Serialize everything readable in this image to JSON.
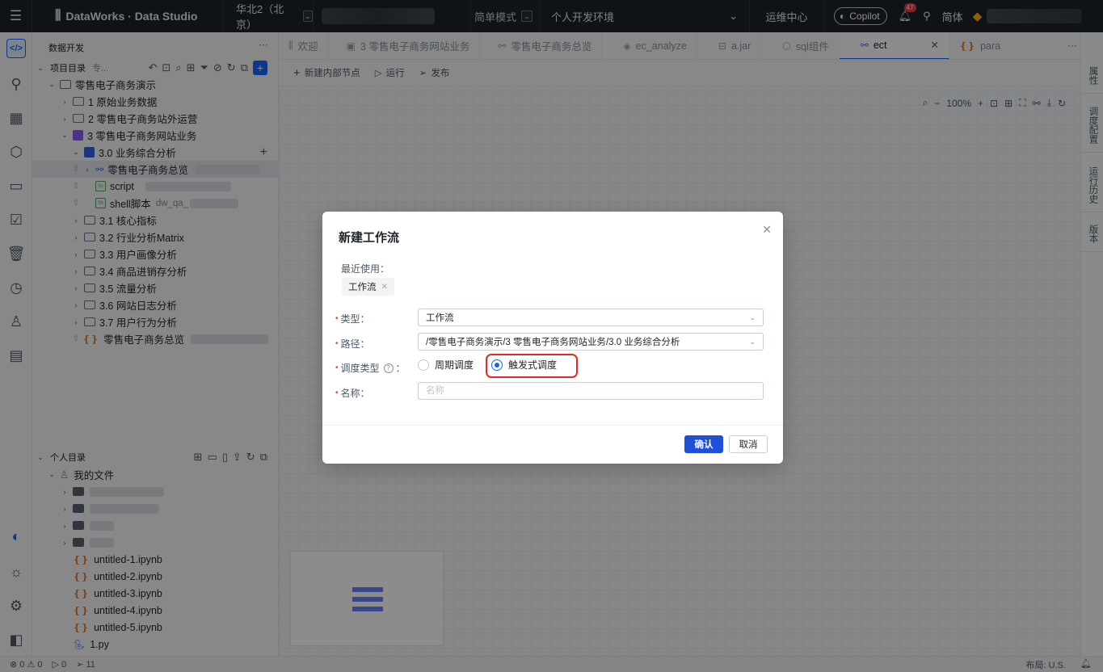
{
  "topbar": {
    "brand": "DataWorks · Data Studio",
    "region": "华北2（北京）",
    "mode": "简单模式",
    "environment": "个人开发环境",
    "ops_center": "运维中心",
    "copilot": "Copilot",
    "notifications": "47",
    "language": "简体"
  },
  "sidebar": {
    "title": "数据开发",
    "project_section": "项目目录",
    "project_section_suffix": "专...",
    "tree": [
      {
        "label": "零售电子商务演示"
      },
      {
        "label": "1 原始业务数据"
      },
      {
        "label": "2 零售电子商务站外运营"
      },
      {
        "label": "3 零售电子商务网站业务"
      },
      {
        "label": "3.0 业务综合分析"
      },
      {
        "label": "零售电子商务总览"
      },
      {
        "label": "script"
      },
      {
        "label": "shell脚本",
        "suffix": "dw_qa_"
      },
      {
        "label": "3.1 核心指标"
      },
      {
        "label": "3.2 行业分析Matrix"
      },
      {
        "label": "3.3 用户画像分析"
      },
      {
        "label": "3.4 商品进销存分析"
      },
      {
        "label": "3.5 流量分析"
      },
      {
        "label": "3.6 网站日志分析"
      },
      {
        "label": "3.7 用户行为分析"
      },
      {
        "label": "零售电子商务总览"
      }
    ],
    "personal_section": "个人目录",
    "my_files": "我的文件",
    "files": [
      "untitled-1.ipynb",
      "untitled-2.ipynb",
      "untitled-3.ipynb",
      "untitled-4.ipynb",
      "untitled-5.ipynb",
      "1.py"
    ]
  },
  "tabs": [
    {
      "label": "欢迎"
    },
    {
      "label": "3 零售电子商务网站业务"
    },
    {
      "label": "零售电子商务总览"
    },
    {
      "label": "ec_analyze"
    },
    {
      "label": "a.jar"
    },
    {
      "label": "sql组件"
    },
    {
      "label": "ect"
    },
    {
      "label": "para"
    }
  ],
  "toolbar": {
    "add_node": "新建内部节点",
    "run": "运行",
    "publish": "发布"
  },
  "canvas": {
    "zoom": "100%"
  },
  "right_rail": [
    "属性",
    "调度配置",
    "运行历史",
    "版本"
  ],
  "modal": {
    "title": "新建工作流",
    "recent_label": "最近使用：",
    "recent_tag": "工作流",
    "type_label": "类型：",
    "type_value": "工作流",
    "path_label": "路径：",
    "path_value": "/零售电子商务演示/3 零售电子商务网站业务/3.0 业务综合分析",
    "schedule_label": "调度类型",
    "schedule_options": [
      "周期调度",
      "触发式调度"
    ],
    "schedule_selected": "触发式调度",
    "name_label": "名称：",
    "name_placeholder": "名称",
    "confirm": "确认",
    "cancel": "取消"
  },
  "statusbar": {
    "errors": "0",
    "warnings": "0",
    "ports": "0",
    "sends": "11",
    "layout": "布局: U.S."
  }
}
